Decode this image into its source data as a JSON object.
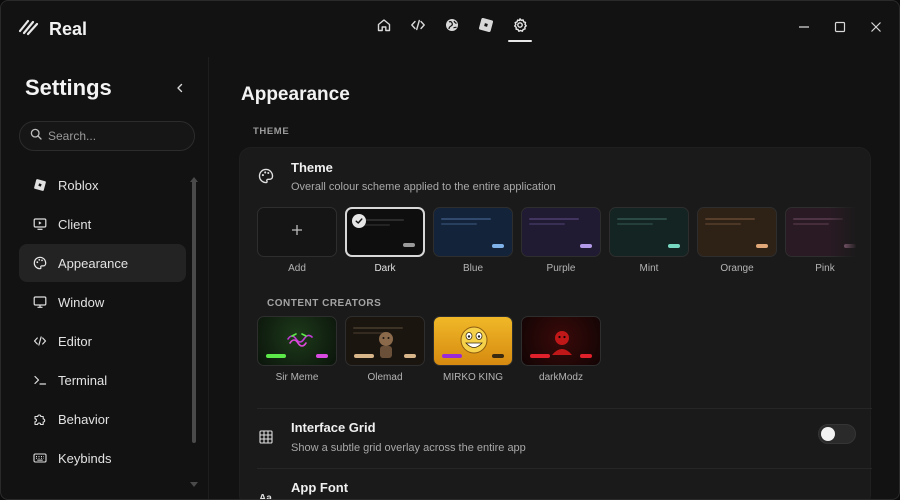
{
  "app": {
    "name": "Real"
  },
  "topnav": {
    "items": [
      "home-icon",
      "code-icon",
      "globe-icon",
      "roblox-icon",
      "settings-icon"
    ],
    "active": "settings-icon"
  },
  "window_controls": [
    "minimize",
    "maximize",
    "close"
  ],
  "sidebar": {
    "title": "Settings",
    "search_placeholder": "Search...",
    "items": [
      {
        "label": "Roblox",
        "icon": "roblox-icon"
      },
      {
        "label": "Client",
        "icon": "monitor-play-icon"
      },
      {
        "label": "Appearance",
        "icon": "palette-icon",
        "active": true
      },
      {
        "label": "Window",
        "icon": "window-icon"
      },
      {
        "label": "Editor",
        "icon": "code-icon"
      },
      {
        "label": "Terminal",
        "icon": "terminal-icon"
      },
      {
        "label": "Behavior",
        "icon": "puzzle-icon"
      },
      {
        "label": "Keybinds",
        "icon": "keyboard-icon"
      }
    ]
  },
  "main": {
    "title": "Appearance",
    "section_label": "THEME",
    "theme": {
      "title": "Theme",
      "description": "Overall colour scheme applied to the entire application",
      "options": [
        {
          "label": "Add",
          "kind": "add"
        },
        {
          "label": "Dark",
          "bg": "#0e0e0e",
          "accent": "#9a9a9a",
          "selected": true
        },
        {
          "label": "Blue",
          "bg": "#13233a",
          "accent": "#7fb2e8"
        },
        {
          "label": "Purple",
          "bg": "#201a33",
          "accent": "#b39ae8"
        },
        {
          "label": "Mint",
          "bg": "#132422",
          "accent": "#76d8c0"
        },
        {
          "label": "Orange",
          "bg": "#2e2116",
          "accent": "#e0a778"
        },
        {
          "label": "Pink",
          "bg": "#2a1a24",
          "accent": "#d58fb8"
        }
      ]
    },
    "content_creators": {
      "label": "CONTENT CREATORS",
      "items": [
        {
          "label": "Sir Meme",
          "bg": "#0f1d10",
          "bar1": "#5de84a",
          "bar2": "#d94ae0"
        },
        {
          "label": "Olemad",
          "bg": "#1b1510",
          "bar1": "#d9b58a",
          "bar2": "#d9b58a"
        },
        {
          "label": "MIRKO KING",
          "bg": "#e0a21a",
          "bar1": "#9a2ad8",
          "bar2": "#3a2a10"
        },
        {
          "label": "darkModz",
          "bg": "#1a0606",
          "bar1": "#e0202a",
          "bar2": "#e0202a"
        }
      ]
    },
    "interface_grid": {
      "title": "Interface Grid",
      "description": "Show a subtle grid overlay across the entire app",
      "enabled": false
    },
    "app_font": {
      "title": "App Font"
    }
  }
}
